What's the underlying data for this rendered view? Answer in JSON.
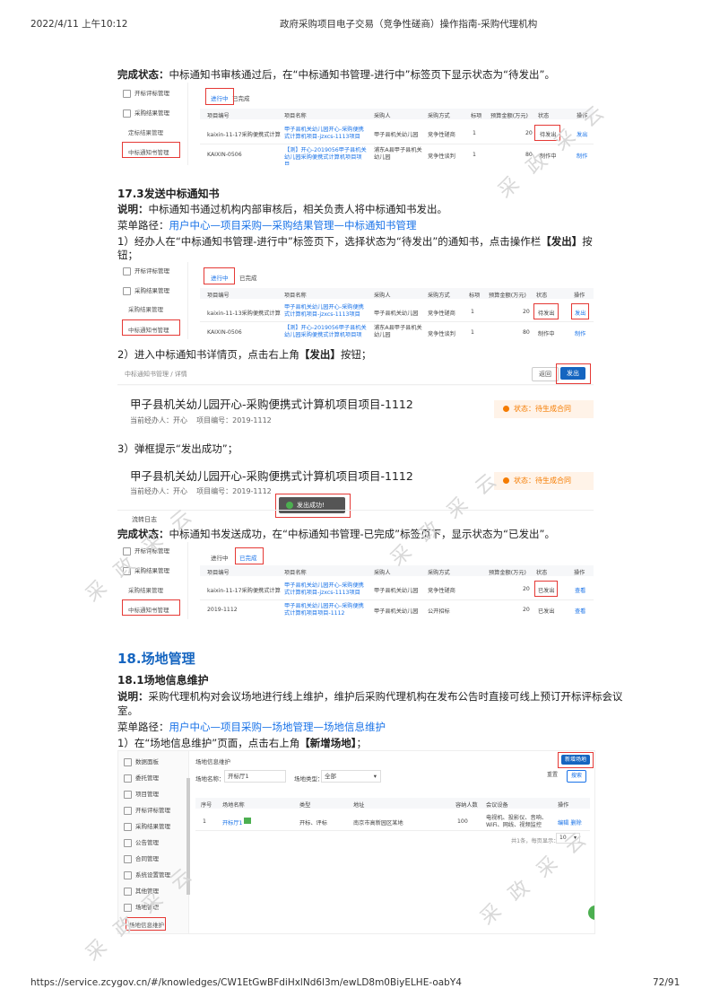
{
  "header": {
    "datetime": "2022/4/11 上午10:12",
    "title": "政府采购项目电子交易（竞争性磋商）操作指南-采购代理机构"
  },
  "footer": {
    "url": "https://service.zcygov.cn/#/knowledges/CW1EtGwBFdiHxlNd6l3m/ewLD8m0BiyELHE-oabY4",
    "page": "72/91"
  },
  "para_top": {
    "label": "完成状态：",
    "text": "中标通知书审核通过后，在“中标通知书管理-进行中”标签页下显示状态为“待发出”。"
  },
  "shot1": {
    "side": [
      "开标评标管理",
      "采购结果管理",
      "定标结果管理",
      "中标通知书管理"
    ],
    "tabs": [
      "进行中",
      "已完成"
    ],
    "cols": [
      "项目编号",
      "项目名称",
      "采购人",
      "采购方式",
      "标项",
      "预算金额(万元)",
      "状态",
      "操作"
    ],
    "rows": [
      [
        "kaixin-11-17采购便携式计算机",
        "甲子县机关幼儿园开心-采购便携式计算机项目-jzxcs-1113项目",
        "甲子县机关幼儿园",
        "竞争性磋商",
        "1",
        "20",
        "待发出",
        "发出"
      ],
      [
        "KAIXIN-0506",
        "【测】开心-2019056甲子县机关幼儿园采购便携式计算机项目项目",
        "浦东A县甲子县机关幼儿园",
        "竞争性谈判",
        "1",
        "80",
        "制作中",
        "制作"
      ]
    ]
  },
  "sec17_3": {
    "title": "17.3发送中标通知书",
    "desc_label": "说明：",
    "desc": "中标通知书通过机构内部审核后，相关负责人将中标通知书发出。",
    "menu_label": "菜单路径：",
    "menu_path": "用户中心—项目采购—采购结果管理—中标通知书管理",
    "step1a": "1）经办人在“中标通知书管理-进行中”标签页下，选择状态为“待发出”的通知书，点击操作栏",
    "step1b": "【发出】",
    "step1c": "按",
    "step1d": "钮；",
    "step2a": "2）进入中标通知书详情页，点击右上角",
    "step2b": "【发出】",
    "step2c": "按钮；",
    "step3": "3）弹框提示“发出成功”；",
    "done_label": "完成状态：",
    "done_text": "中标通知书发送成功，在“中标通知书管理-已完成”标签页下，显示状态为“已发出”。"
  },
  "shot2": {
    "side": [
      "开标评标管理",
      "采购结果管理",
      "采购结果管理",
      "中标通知书管理"
    ],
    "tabs": [
      "进行中",
      "已完成"
    ],
    "cols": [
      "项目编号",
      "项目名称",
      "采购人",
      "采购方式",
      "标项",
      "预算金额(万元)",
      "状态",
      "操作"
    ],
    "rows": [
      [
        "kaixin-11-13采购便携式计算机",
        "甲子县机关幼儿园开心-采购便携式计算机项目-jzxcs-1113项目",
        "甲子县机关幼儿园",
        "竞争性磋商",
        "1",
        "20",
        "待发出",
        "发出"
      ],
      [
        "KAIXIN-0506",
        "【测】开心-2019056甲子县机关幼儿园采购便携式计算机项目项目",
        "浦东A县甲子县机关幼儿园",
        "竞争性谈判",
        "1",
        "80",
        "制作中",
        "制作"
      ]
    ]
  },
  "shot3": {
    "breadcrumb": "中标通知书管理 / 详情",
    "back": "返回",
    "send": "发出",
    "project": "甲子县机关幼儿园开心-采购便携式计算机项目项目-1112",
    "handler": "当前经办人：开心",
    "code": "项目编号：2019-1112",
    "status": "状态：待生成合同"
  },
  "shot4": {
    "project": "甲子县机关幼儿园开心-采购便携式计算机项目项目-1112",
    "handler": "当前经办人：开心",
    "code": "项目编号：2019-1112",
    "status": "状态：待生成合同",
    "toast": "发出成功!",
    "log": "流转日志"
  },
  "shot5": {
    "side": [
      "开标评标管理",
      "采购结果管理",
      "采购结果管理",
      "中标通知书管理"
    ],
    "tabs": [
      "进行中",
      "已完成"
    ],
    "cols": [
      "项目编号",
      "项目名称",
      "采购人",
      "采购方式",
      "预算金额(万元)",
      "状态",
      "操作"
    ],
    "rows": [
      [
        "kaixin-11-17采购便携式计算机",
        "甲子县机关幼儿园开心-采购便携式计算机项目-jzxcs-1113项目",
        "甲子县机关幼儿园",
        "竞争性磋商",
        "20",
        "已发出",
        "查看"
      ],
      [
        "2019-1112",
        "甲子县机关幼儿园开心-采购便携式计算机项目项目-1112",
        "甲子县机关幼儿园",
        "公开招标",
        "20",
        "已发出",
        "查看"
      ]
    ]
  },
  "sec18": {
    "title": "18.场地管理",
    "sub": "18.1场地信息维护",
    "desc_label": "说明：",
    "desc1": "采购代理机构对会议场地进行线上维护，维护后采购代理机构在发布公告时直接可线上预订开标评标会议",
    "desc2": "室。",
    "menu_label": "菜单路径：",
    "menu_path": "用户中心—项目采购—场地管理—场地信息维护",
    "step1a": "1）在“场地信息维护”页面，点击右上角",
    "step1b": "【新增场地】",
    "step1c": "；"
  },
  "shot6": {
    "side": [
      "数据面板",
      "委托管理",
      "项目管理",
      "开标评标管理",
      "采购结果管理",
      "公告管理",
      "合同管理",
      "系统设置管理",
      "其他管理",
      "场地管理",
      "场地信息维护"
    ],
    "title": "场地信息维护",
    "add": "新增场地",
    "name_label": "场地名称：",
    "name_value": "开标厅1",
    "type_label": "场地类型：",
    "type_value": "全部",
    "reset": "重置",
    "search": "搜索",
    "cols": [
      "序号",
      "场地名称",
      "类型",
      "地址",
      "容纳人数",
      "会议设备",
      "操作"
    ],
    "row": [
      "1",
      "开标厅1",
      "开标、评标",
      "南京市高新园区某地",
      "100",
      "电视机、投影仪、音响、WiFi、网线、视频监控",
      "编辑 删除"
    ],
    "pager": "共1条，每页显示：",
    "pagesize": "10"
  },
  "watermark": "采 政 采 云"
}
